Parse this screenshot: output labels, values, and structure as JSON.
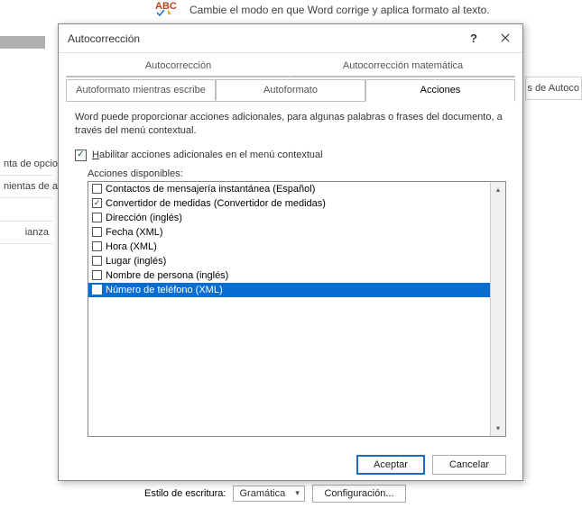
{
  "bg": {
    "top_text": "Cambie el modo en que Word corrige y aplica formato al texto.",
    "left_items": [
      "nta de opcio",
      "nientas de a",
      "",
      "ianza"
    ],
    "right_label": "s de Autoco",
    "bottom": {
      "label": "Estilo de escritura:",
      "select_value": "Gramática",
      "config_btn": "Configuración..."
    }
  },
  "dialog": {
    "title": "Autocorrección",
    "tabs_row1": [
      "Autocorrección",
      "Autocorrección matemática"
    ],
    "tabs_row2": [
      "Autoformato mientras escribe",
      "Autoformato",
      "Acciones"
    ],
    "description": "Word puede proporcionar acciones adicionales, para algunas palabras o frases del documento, a través del menú contextual.",
    "enable_prefix": "H",
    "enable_text": "abilitar acciones adicionales en el menú contextual",
    "list_label": "Acciones disponibles:",
    "items": [
      {
        "label": "Contactos de mensajería instantánea (Español)",
        "checked": false,
        "selected": false
      },
      {
        "label": "Convertidor de medidas (Convertidor de medidas)",
        "checked": true,
        "selected": false
      },
      {
        "label": "Dirección (inglés)",
        "checked": false,
        "selected": false
      },
      {
        "label": "Fecha (XML)",
        "checked": false,
        "selected": false
      },
      {
        "label": "Hora (XML)",
        "checked": false,
        "selected": false
      },
      {
        "label": "Lugar (inglés)",
        "checked": false,
        "selected": false
      },
      {
        "label": "Nombre de persona (inglés)",
        "checked": false,
        "selected": false
      },
      {
        "label": "Número de teléfono (XML)",
        "checked": false,
        "selected": true
      }
    ],
    "ok_btn": "Aceptar",
    "cancel_btn": "Cancelar"
  }
}
